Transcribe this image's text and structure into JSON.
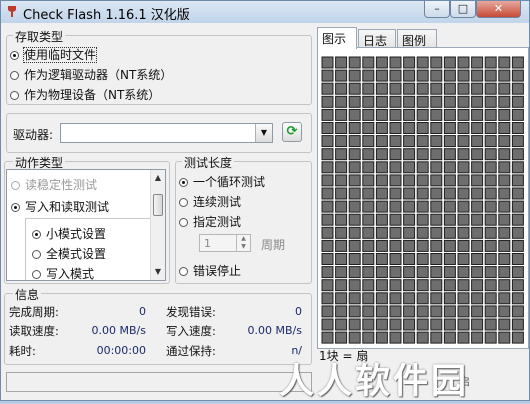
{
  "window": {
    "title": "Check Flash 1.16.1 汉化版",
    "min": "–",
    "max": "□",
    "close": "✕"
  },
  "access": {
    "legend": "存取类型",
    "options": [
      "使用临时文件",
      "作为逻辑驱动器（NT系统）",
      "作为物理设备（NT系统）"
    ],
    "selected": 0
  },
  "drive": {
    "label": "驱动器:",
    "value": "",
    "dropdown_glyph": "▼",
    "refresh_glyph": "⟳"
  },
  "action": {
    "legend": "动作类型",
    "options": [
      "读稳定性测试",
      "写入和读取测试"
    ],
    "sub_options": [
      "小模式设置",
      "全模式设置",
      "写入模式"
    ]
  },
  "length": {
    "legend": "测试长度",
    "options": [
      "一个循环测试",
      "连续测试",
      "指定测试",
      "错误停止"
    ],
    "spin_value": "1",
    "spin_unit": "周期"
  },
  "info": {
    "legend": "信息",
    "completed_label": "完成周期:",
    "completed_value": "0",
    "errors_label": "发现错误:",
    "errors_value": "0",
    "read_label": "读取速度:",
    "read_value": "0.00 MB/s",
    "write_label": "写入速度:",
    "write_value": "0.00 MB/s",
    "time_label": "耗时:",
    "time_value": "00:00:00",
    "hold_label": "通过保持:",
    "hold_value": "n/"
  },
  "tabs": [
    "图示",
    "日志",
    "图例"
  ],
  "map": {
    "rows": 22,
    "cols": 15,
    "cell_color": "#6e6e6e",
    "border_color": "#1f1f1f"
  },
  "map_legend": "1块 = 扇",
  "partial_buttons": [
    "?",
    "启"
  ],
  "watermark": "人人软件园"
}
